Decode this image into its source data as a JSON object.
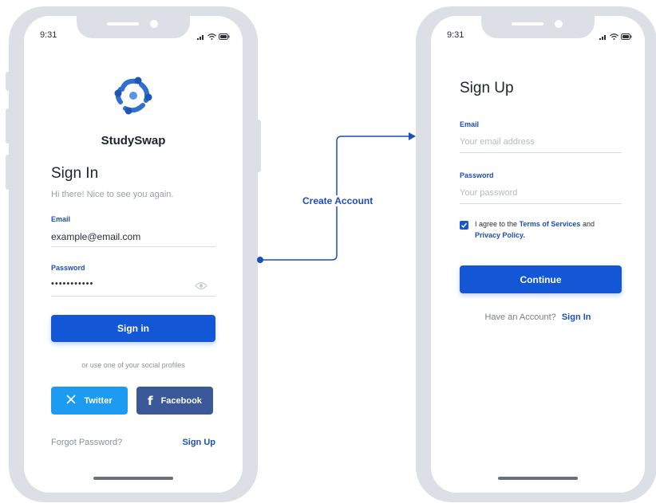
{
  "status_bar": {
    "time": "9:31"
  },
  "signin": {
    "brand": "StudySwap",
    "title": "Sign In",
    "subtitle": "Hi there! Nice to see you again.",
    "email_label": "Email",
    "email_value": "example@email.com",
    "password_label": "Password",
    "password_value": "•••••••••••",
    "submit": "Sign in",
    "social_note": "or use one of your social profiles",
    "twitter": "Twitter",
    "facebook": "Facebook",
    "forgot": "Forgot Password?",
    "signup_link": "Sign Up"
  },
  "flow": {
    "label": "Create Account"
  },
  "signup": {
    "title": "Sign Up",
    "email_label": "Email",
    "email_placeholder": "Your email address",
    "password_label": "Password",
    "password_placeholder": "Your password",
    "agree_prefix": "I agree to the",
    "terms": "Terms of Services",
    "and": "and",
    "privacy": "Privacy Policy.",
    "submit": "Continue",
    "have_account": "Have an Account?",
    "signin_link": "Sign In"
  },
  "colors": {
    "primary": "#1357d6",
    "twitter": "#1d9bf0",
    "facebook": "#3b5998",
    "label": "#1d4fb8",
    "frame": "#dcdfe5"
  },
  "icons": [
    "studyswap-logo-icon",
    "signal-icon",
    "wifi-icon",
    "battery-icon",
    "eye-icon",
    "x-twitter-icon",
    "facebook-icon",
    "checkmark-icon"
  ]
}
